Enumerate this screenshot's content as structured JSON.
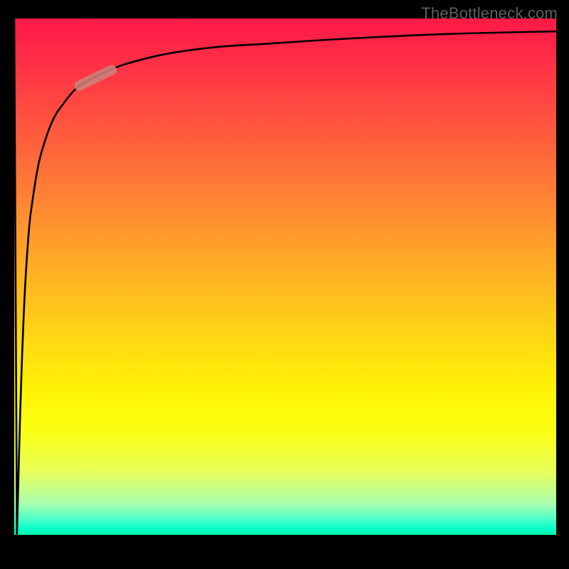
{
  "watermark": "TheBottleneck.com",
  "chart_data": {
    "type": "line",
    "title": "",
    "xlabel": "",
    "ylabel": "",
    "xlim": [
      0,
      100
    ],
    "ylim": [
      0,
      100
    ],
    "grid": false,
    "series": [
      {
        "name": "curve",
        "x": [
          0,
          0.5,
          1,
          2,
          3,
          5,
          8,
          12,
          20,
          30,
          45,
          60,
          80,
          100
        ],
        "y": [
          100,
          0,
          20,
          48,
          62,
          74,
          82,
          87,
          91,
          93.5,
          95,
          96,
          97,
          97.5
        ]
      }
    ],
    "marker": {
      "x_range": [
        12,
        18
      ],
      "y_range": [
        86,
        90
      ],
      "color": "#cd847c",
      "opacity": 0.85
    },
    "background_gradient": {
      "direction": "vertical",
      "stops": [
        {
          "pos": 0,
          "color": "#ff1a47"
        },
        {
          "pos": 0.35,
          "color": "#ff8a30"
        },
        {
          "pos": 0.65,
          "color": "#ffe010"
        },
        {
          "pos": 0.85,
          "color": "#f0ff50"
        },
        {
          "pos": 0.97,
          "color": "#60ffc0"
        },
        {
          "pos": 1.0,
          "color": "#00ffa8"
        }
      ]
    }
  }
}
